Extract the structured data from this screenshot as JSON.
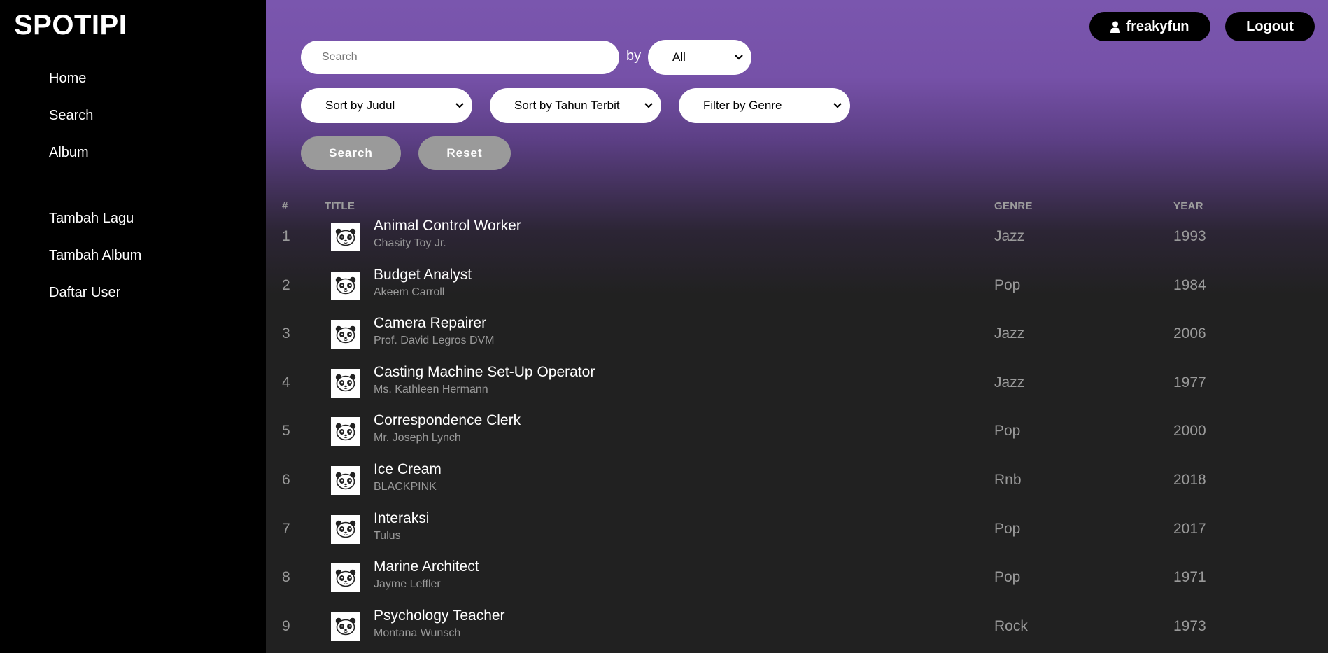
{
  "app": {
    "logo": "SPOTIPI"
  },
  "sidebar": {
    "items": [
      {
        "label": "Home"
      },
      {
        "label": "Search"
      },
      {
        "label": "Album"
      },
      {
        "label": "Tambah Lagu"
      },
      {
        "label": "Tambah Album"
      },
      {
        "label": "Daftar User"
      }
    ]
  },
  "header": {
    "username": "freakyfun",
    "user_icon": "user-icon",
    "logout_label": "Logout"
  },
  "search": {
    "placeholder": "Search",
    "value": "",
    "by_label": "by",
    "by_selected": "All"
  },
  "filters": {
    "sort_title": "Sort by Judul",
    "sort_year": "Sort by Tahun Terbit",
    "filter_genre": "Filter by Genre"
  },
  "actions": {
    "search_label": "Search",
    "reset_label": "Reset"
  },
  "table": {
    "headers": {
      "num": "#",
      "title": "TITLE",
      "genre": "GENRE",
      "year": "YEAR"
    },
    "rows": [
      {
        "num": "1",
        "title": "Animal Control Worker",
        "artist": "Chasity Toy Jr.",
        "genre": "Jazz",
        "year": "1993"
      },
      {
        "num": "2",
        "title": "Budget Analyst",
        "artist": "Akeem Carroll",
        "genre": "Pop",
        "year": "1984"
      },
      {
        "num": "3",
        "title": "Camera Repairer",
        "artist": "Prof. David Legros DVM",
        "genre": "Jazz",
        "year": "2006"
      },
      {
        "num": "4",
        "title": "Casting Machine Set-Up Operator",
        "artist": "Ms. Kathleen Hermann",
        "genre": "Jazz",
        "year": "1977"
      },
      {
        "num": "5",
        "title": "Correspondence Clerk",
        "artist": "Mr. Joseph Lynch",
        "genre": "Pop",
        "year": "2000"
      },
      {
        "num": "6",
        "title": "Ice Cream",
        "artist": "BLACKPINK",
        "genre": "Rnb",
        "year": "2018"
      },
      {
        "num": "7",
        "title": "Interaksi",
        "artist": "Tulus",
        "genre": "Pop",
        "year": "2017"
      },
      {
        "num": "8",
        "title": "Marine Architect",
        "artist": "Jayme Leffler",
        "genre": "Pop",
        "year": "1971"
      },
      {
        "num": "9",
        "title": "Psychology Teacher",
        "artist": "Montana Wunsch",
        "genre": "Rock",
        "year": "1973"
      }
    ]
  },
  "colors": {
    "accent": "#7a56ae",
    "sidebar": "#000000",
    "background": "#212121"
  }
}
